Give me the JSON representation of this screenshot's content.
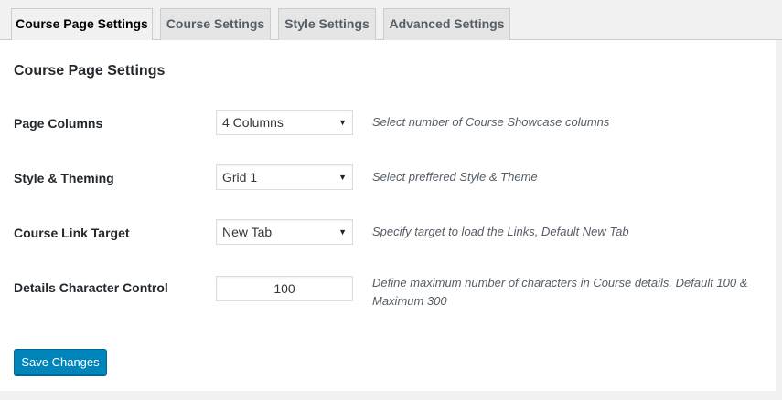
{
  "tabs": [
    {
      "label": "Course Page Settings",
      "active": true
    },
    {
      "label": "Course Settings",
      "active": false
    },
    {
      "label": "Style Settings",
      "active": false
    },
    {
      "label": "Advanced Settings",
      "active": false
    }
  ],
  "panel": {
    "title": "Course Page Settings",
    "rows": [
      {
        "label": "Page Columns",
        "control": "select",
        "value": "4 Columns",
        "description": "Select number of Course Showcase columns"
      },
      {
        "label": "Style & Theming",
        "control": "select",
        "value": "Grid 1",
        "description": "Select preffered Style & Theme"
      },
      {
        "label": "Course Link Target",
        "control": "select",
        "value": "New Tab",
        "description": "Specify target to load the Links, Default New Tab"
      },
      {
        "label": "Details Character Control",
        "control": "text",
        "value": "100",
        "description": "Define maximum number of characters in Course details. Default 100 & Maximum 300"
      }
    ],
    "save_label": "Save Changes"
  },
  "icons": {
    "dropdown_arrow": "▼"
  },
  "colors": {
    "primary_button": "#0085ba",
    "page_background": "#f1f1f1",
    "panel_background": "#ffffff"
  }
}
